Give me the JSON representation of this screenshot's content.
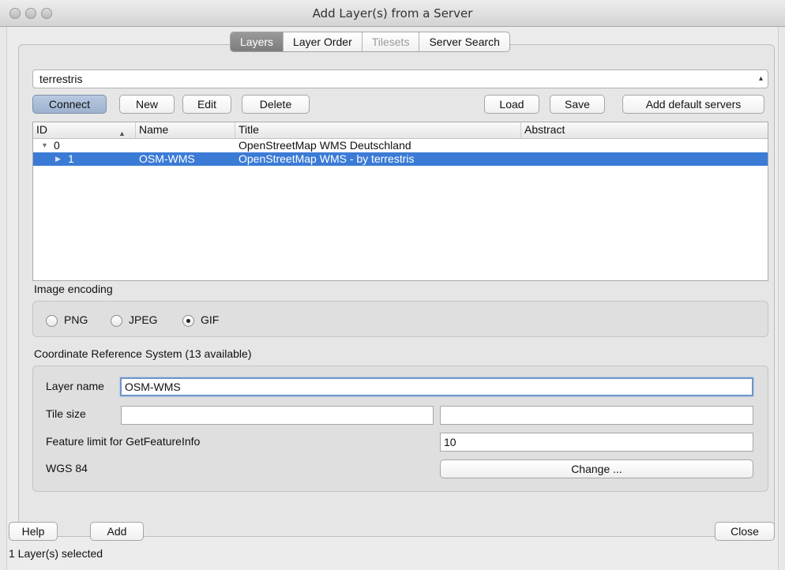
{
  "window": {
    "title": "Add Layer(s) from a Server"
  },
  "tabs": [
    {
      "label": "Layers"
    },
    {
      "label": "Layer Order"
    },
    {
      "label": "Tilesets"
    },
    {
      "label": "Server Search"
    }
  ],
  "server": {
    "selected": "terrestris"
  },
  "toolbar": {
    "connect": "Connect",
    "new": "New",
    "edit": "Edit",
    "delete": "Delete",
    "load": "Load",
    "save": "Save",
    "add_default": "Add default servers"
  },
  "layers_table": {
    "columns": [
      "ID",
      "Name",
      "Title",
      "Abstract"
    ],
    "rows": [
      {
        "id": "0",
        "name": "",
        "title": "OpenStreetMap WMS Deutschland",
        "abstract": ""
      },
      {
        "id": "1",
        "name": "OSM-WMS",
        "title": "OpenStreetMap WMS - by terrestris",
        "abstract": ""
      }
    ]
  },
  "image_encoding": {
    "label": "Image encoding",
    "options": [
      "PNG",
      "JPEG",
      "GIF"
    ],
    "selected": "GIF"
  },
  "crs": {
    "label": "Coordinate Reference System (13 available)",
    "layer_name_label": "Layer name",
    "layer_name_value": "OSM-WMS",
    "tile_size_label": "Tile size",
    "tile_width": "",
    "tile_height": "",
    "feature_limit_label": "Feature limit for GetFeatureInfo",
    "feature_limit_value": "10",
    "crs_name": "WGS 84",
    "change_label": "Change ..."
  },
  "footer": {
    "help": "Help",
    "add": "Add",
    "close": "Close",
    "status": "1 Layer(s) selected"
  },
  "colors": {
    "selection": "#3b7bd6",
    "active_tab": "#8a8a8a"
  }
}
